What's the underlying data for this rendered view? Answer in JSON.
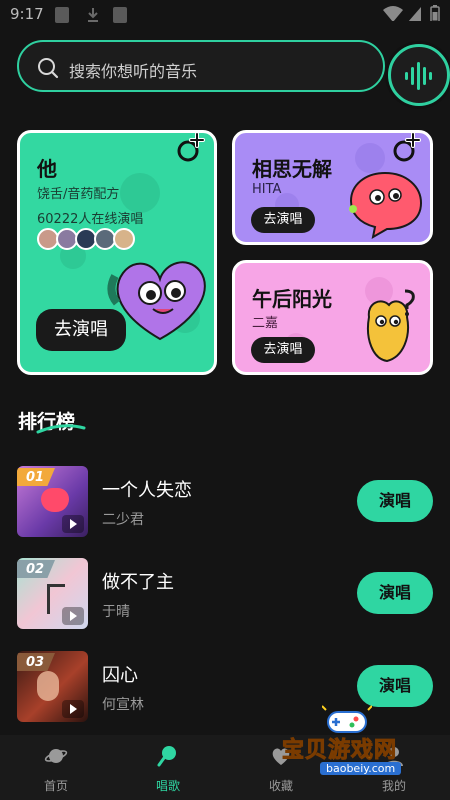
{
  "status_bar": {
    "time": "9:17"
  },
  "search": {
    "placeholder": "搜索你想听的音乐"
  },
  "featured": {
    "big_card": {
      "title": "他",
      "subtitle": "饶舌/音药配方",
      "online": "60222人在线演唱",
      "button": "去演唱",
      "color": "#33d8a1"
    },
    "small_cards": [
      {
        "title": "相思无解",
        "artist": "HITA",
        "button": "去演唱",
        "color": "#a98cf5"
      },
      {
        "title": "午后阳光",
        "artist": "二嘉",
        "button": "去演唱",
        "color": "#f7a5e6"
      }
    ]
  },
  "ranking": {
    "title": "排行榜",
    "items": [
      {
        "rank": "01",
        "song": "一个人失恋",
        "artist": "二少君",
        "button": "演唱"
      },
      {
        "rank": "02",
        "song": "做不了主",
        "artist": "于晴",
        "button": "演唱"
      },
      {
        "rank": "03",
        "song": "囚心",
        "artist": "何宣林",
        "button": "演唱"
      }
    ]
  },
  "bottom_nav": [
    {
      "label": "首页",
      "icon": "planet-icon",
      "active": false
    },
    {
      "label": "唱歌",
      "icon": "microphone-icon",
      "active": true
    },
    {
      "label": "收藏",
      "icon": "heart-icon",
      "active": false
    },
    {
      "label": "我的",
      "icon": "user-icon",
      "active": false
    }
  ],
  "watermark": {
    "title": "宝贝游戏网",
    "url": "baobeiy.com"
  },
  "colors": {
    "accent": "#2fd6a2",
    "background": "#141414"
  }
}
